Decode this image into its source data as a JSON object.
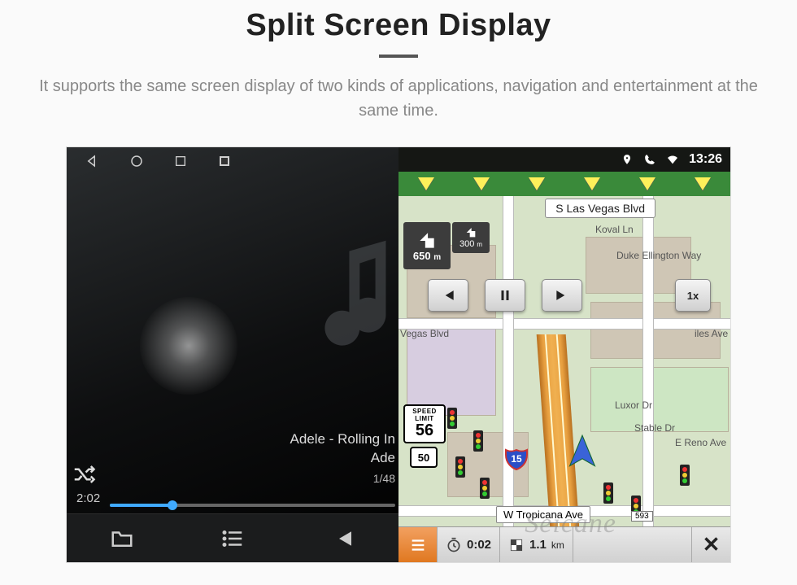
{
  "header": {
    "title": "Split Screen Display",
    "subtitle": "It supports the same screen display of two kinds of applications, navigation and entertainment at the same time."
  },
  "android_nav": {
    "back": "◁",
    "home": "○",
    "recent": "□",
    "gallery": "▣"
  },
  "music": {
    "track_line1": "Adele - Rolling In",
    "track_line2": "Ade",
    "counter": "1/48",
    "elapsed": "2:02",
    "shuffle_icon": "shuffle",
    "bottom": {
      "folder": "folder",
      "list": "list",
      "prev": "prev"
    }
  },
  "status": {
    "location_icon": "location",
    "phone_icon": "phone",
    "wifi_icon": "wifi",
    "time": "13:26"
  },
  "nav": {
    "top_street": "S Las Vegas Blvd",
    "turn_distance": "650",
    "turn_unit": "m",
    "next_distance": "300",
    "next_unit": "m",
    "speed_label1": "SPEED",
    "speed_label2": "LIMIT",
    "speed_value": "56",
    "route_num": "50",
    "interstate_num": "15",
    "playback_speed": "1x",
    "bottom_street": "W Tropicana Ave",
    "exit_num": "593",
    "labels": {
      "koval": "Koval Ln",
      "duke": "Duke Ellington Way",
      "vegas": "Vegas Blvd",
      "miles": "iles Ave",
      "luxor": "Luxor Dr",
      "stable": "Stable Dr",
      "reno": "E Reno Ave"
    },
    "bottom_bar": {
      "eta_value": "0:02",
      "dist_value": "1.1",
      "dist_unit": "km"
    }
  },
  "watermark": "Seicane"
}
